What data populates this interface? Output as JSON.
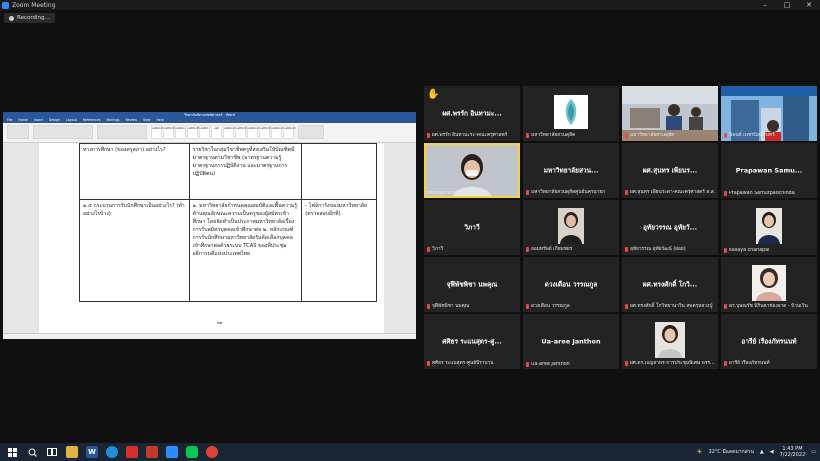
{
  "window": {
    "title": "Zoom Meeting",
    "controls": [
      "–",
      "□",
      "✕"
    ]
  },
  "recording": {
    "label": "Recording..."
  },
  "word": {
    "title": "วิทยาลัยสัตวแพทย์ศาสตร์ - Word",
    "tabs": [
      "File",
      "Home",
      "Insert",
      "Design",
      "Layout",
      "References",
      "Mailings",
      "Review",
      "View",
      "Help"
    ],
    "style_names": [
      "AaBbCcDc",
      "AaBbCcDc",
      "AaBbCc",
      "AaBbCcE",
      "AaBbC",
      "AaB",
      "AaBbCcD",
      "AaBbCcD",
      "AaBbCcD",
      "AaBbCcD",
      "AaBbCcD",
      "AaBbCcD"
    ],
    "page_number": "๒๒",
    "rows": [
      {
        "c1": "ทางการศึกษา (ของครูสภา) อย่างไร?",
        "c2": "รายวิชาในกลุ่มวิชาชีพครูที่ส่งเสริมให้บัณฑิตมีมาตรฐานตามวิชาชีพ (มาตรฐานความรู้ มาตรฐานการปฏิบัติงาน และมาตรฐานการปฏิบัติตน)",
        "c3": ""
      },
      {
        "c1": "๑.๕ กระบวนการรับนักศึกษาเป็นอย่างไร? (ทำอย่างไรบ้าง)",
        "c2": "๑. มหาวิทยาลัยกำหนดคุณสมบัติและพื้นความรู้ ด้านคุณลักษณะความเป็นครูของผู้สมัครเข้าศึกษา โดยจัดทำเป็นประกาศมหาวิทยาลัยเรื่องการรับสมัครบุคคลเข้าศึกษาต่อ ๒. หลักเกณฑ์การรับนักศึกษามหาวิทยาลัยรับคัดเลือกบุคคลเข้าศึกษาต่อด้วยระบบ TCAS ของที่ประชุมอธิการบดีแห่งประเทศไทย",
        "c3": "- ไฟล์การังของมหาวิทยาลัย (ตรวจสอบอีกที)"
      }
    ]
  },
  "participants": [
    {
      "name": "ผศ.พรรัก อินทามะ...",
      "label": "ผศ.พรรัก อินทามะระ-คณะครุศาสตร์",
      "video": false,
      "raised_hand": true
    },
    {
      "name": "",
      "label": "มหาวิทยาลัยสวนดุสิต",
      "video": "logo"
    },
    {
      "name": "",
      "label": "มหาวิทยาลัยสวนดุสิต",
      "video": "room"
    },
    {
      "name": "",
      "label": "นิพนธ์ เพชรนิลศิรินทร์",
      "video": "building"
    },
    {
      "name": "",
      "label": "panpachara pinchinda",
      "video": "person",
      "active": true
    },
    {
      "name": "มหาวิทยาลัยสวน...",
      "label": "มหาวิทยาลัยสวนดุสิตศูนย์นครนายก",
      "video": false
    },
    {
      "name": "ผศ.สุนทร เพียนร...",
      "label": "ผศ.สุนทร เพียนระดา-คณะครุศาสตร์ ส.ส.",
      "video": false
    },
    {
      "name": "Prapawan Samu...",
      "label": "Prapawan Samutpaochinda",
      "video": false
    },
    {
      "name": "วิภาวี",
      "label": "วิภาวี",
      "video": false
    },
    {
      "name": "",
      "label": "ออมทรัพย์ เกียมชยร",
      "video": "person2"
    },
    {
      "name": "อุทัยวรรณ อุทัยวั...",
      "label": "อุทัยวรรณ อุทัยวัฒน์ (ฝอย)",
      "video": false
    },
    {
      "name": "",
      "label": "kallaya chanapai",
      "video": "person3"
    },
    {
      "name": "จุฬีพัชพิชา นพคุณ",
      "label": "จุฬีพัชพิชา นพคุณ",
      "video": false
    },
    {
      "name": "ดวงเดือน วรรณกูล",
      "label": "ดวงเดือน วรรณกูล",
      "video": false
    },
    {
      "name": "ผศ.ทรงศักดิ์ โกวิ...",
      "label": "ผศ.ทรงศักดิ์ โกวิทยานาวิน สพครุหลวงปู่",
      "video": false
    },
    {
      "name": "",
      "label": "ดร.บุษณรัช นิรินคาช่องจาด - บ้านเวิน",
      "video": "person4"
    },
    {
      "name": "ศศิธร ระแนสุตร-ศู...",
      "label": "ศศิธร ระแนสุตร-ศูนย์บีราบาน",
      "video": false
    },
    {
      "name": "Ua-aree Janthon",
      "label": "Ua-aree Janthon",
      "video": false
    },
    {
      "name": "",
      "label": "ผศ.ดร.เบญจาพร-การประชุมพิเศษ พรร...",
      "video": "person5"
    },
    {
      "name": "อารีย์ เรืองภัทรนนท์",
      "label": "อารีย์ เรืองภัทรนนท์",
      "video": false
    }
  ],
  "taskbar": {
    "icons": [
      "windows-logo",
      "search",
      "task-view",
      "file-explorer",
      "word",
      "edge",
      "acrobat",
      "screenshot",
      "zoom",
      "line",
      "chrome"
    ],
    "weather": "32°C มีแดดมากส่วน",
    "time": "1:43 PM",
    "date": "7/22/2022"
  },
  "colors": {
    "accent_blue": "#2b579a",
    "active_border": "#f5d142",
    "muted_mic": "#e24b4b"
  }
}
